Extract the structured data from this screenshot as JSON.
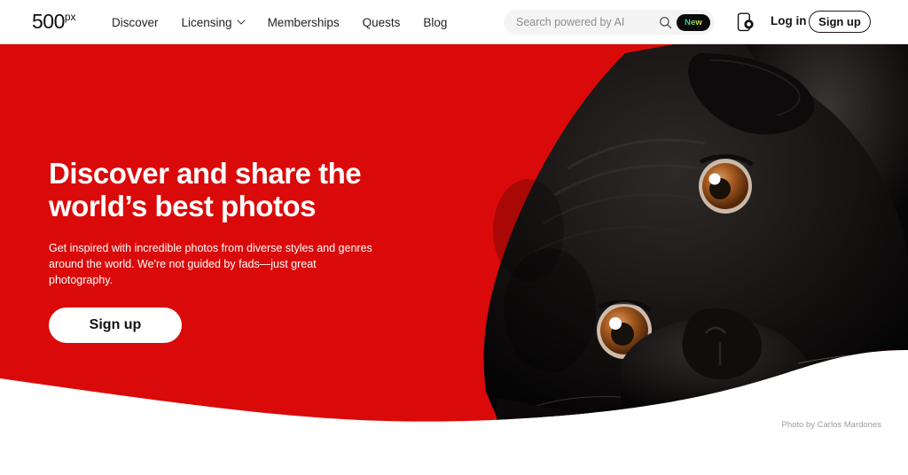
{
  "header": {
    "logo": {
      "main": "500",
      "sup": "px",
      "name": "500px"
    },
    "nav": [
      {
        "label": "Discover",
        "has_chevron": false,
        "icon": ""
      },
      {
        "label": "Licensing",
        "has_chevron": true,
        "icon": "chevron-down-icon"
      },
      {
        "label": "Memberships",
        "has_chevron": false,
        "icon": ""
      },
      {
        "label": "Quests",
        "has_chevron": false,
        "icon": ""
      },
      {
        "label": "Blog",
        "has_chevron": false,
        "icon": ""
      }
    ],
    "search": {
      "placeholder": "Search powered by AI",
      "value": "",
      "icon": "search-icon",
      "badge": "New"
    },
    "app_icon": "mobile-app-icon",
    "login_label": "Log in",
    "signup_label": "Sign up"
  },
  "hero": {
    "title": "Discover and share the world’s best photos",
    "subtitle": "Get inspired with incredible photos from diverse styles and genres around the world. We're not guided by fads—just great photography.",
    "cta_label": "Sign up",
    "photo_credit": "Photo by Carlos Mardones",
    "image_subject": "black-pug-dog-photo"
  },
  "colors": {
    "brand_red": "#da0a0a",
    "badge_bg": "#0a0a0a",
    "badge_gradient_start": "#16c79a",
    "badge_gradient_end": "#f5e663",
    "text_dark": "#141414",
    "search_bg": "#f4f4f4",
    "credit_gray": "#9b9b9b",
    "white": "#ffffff"
  }
}
